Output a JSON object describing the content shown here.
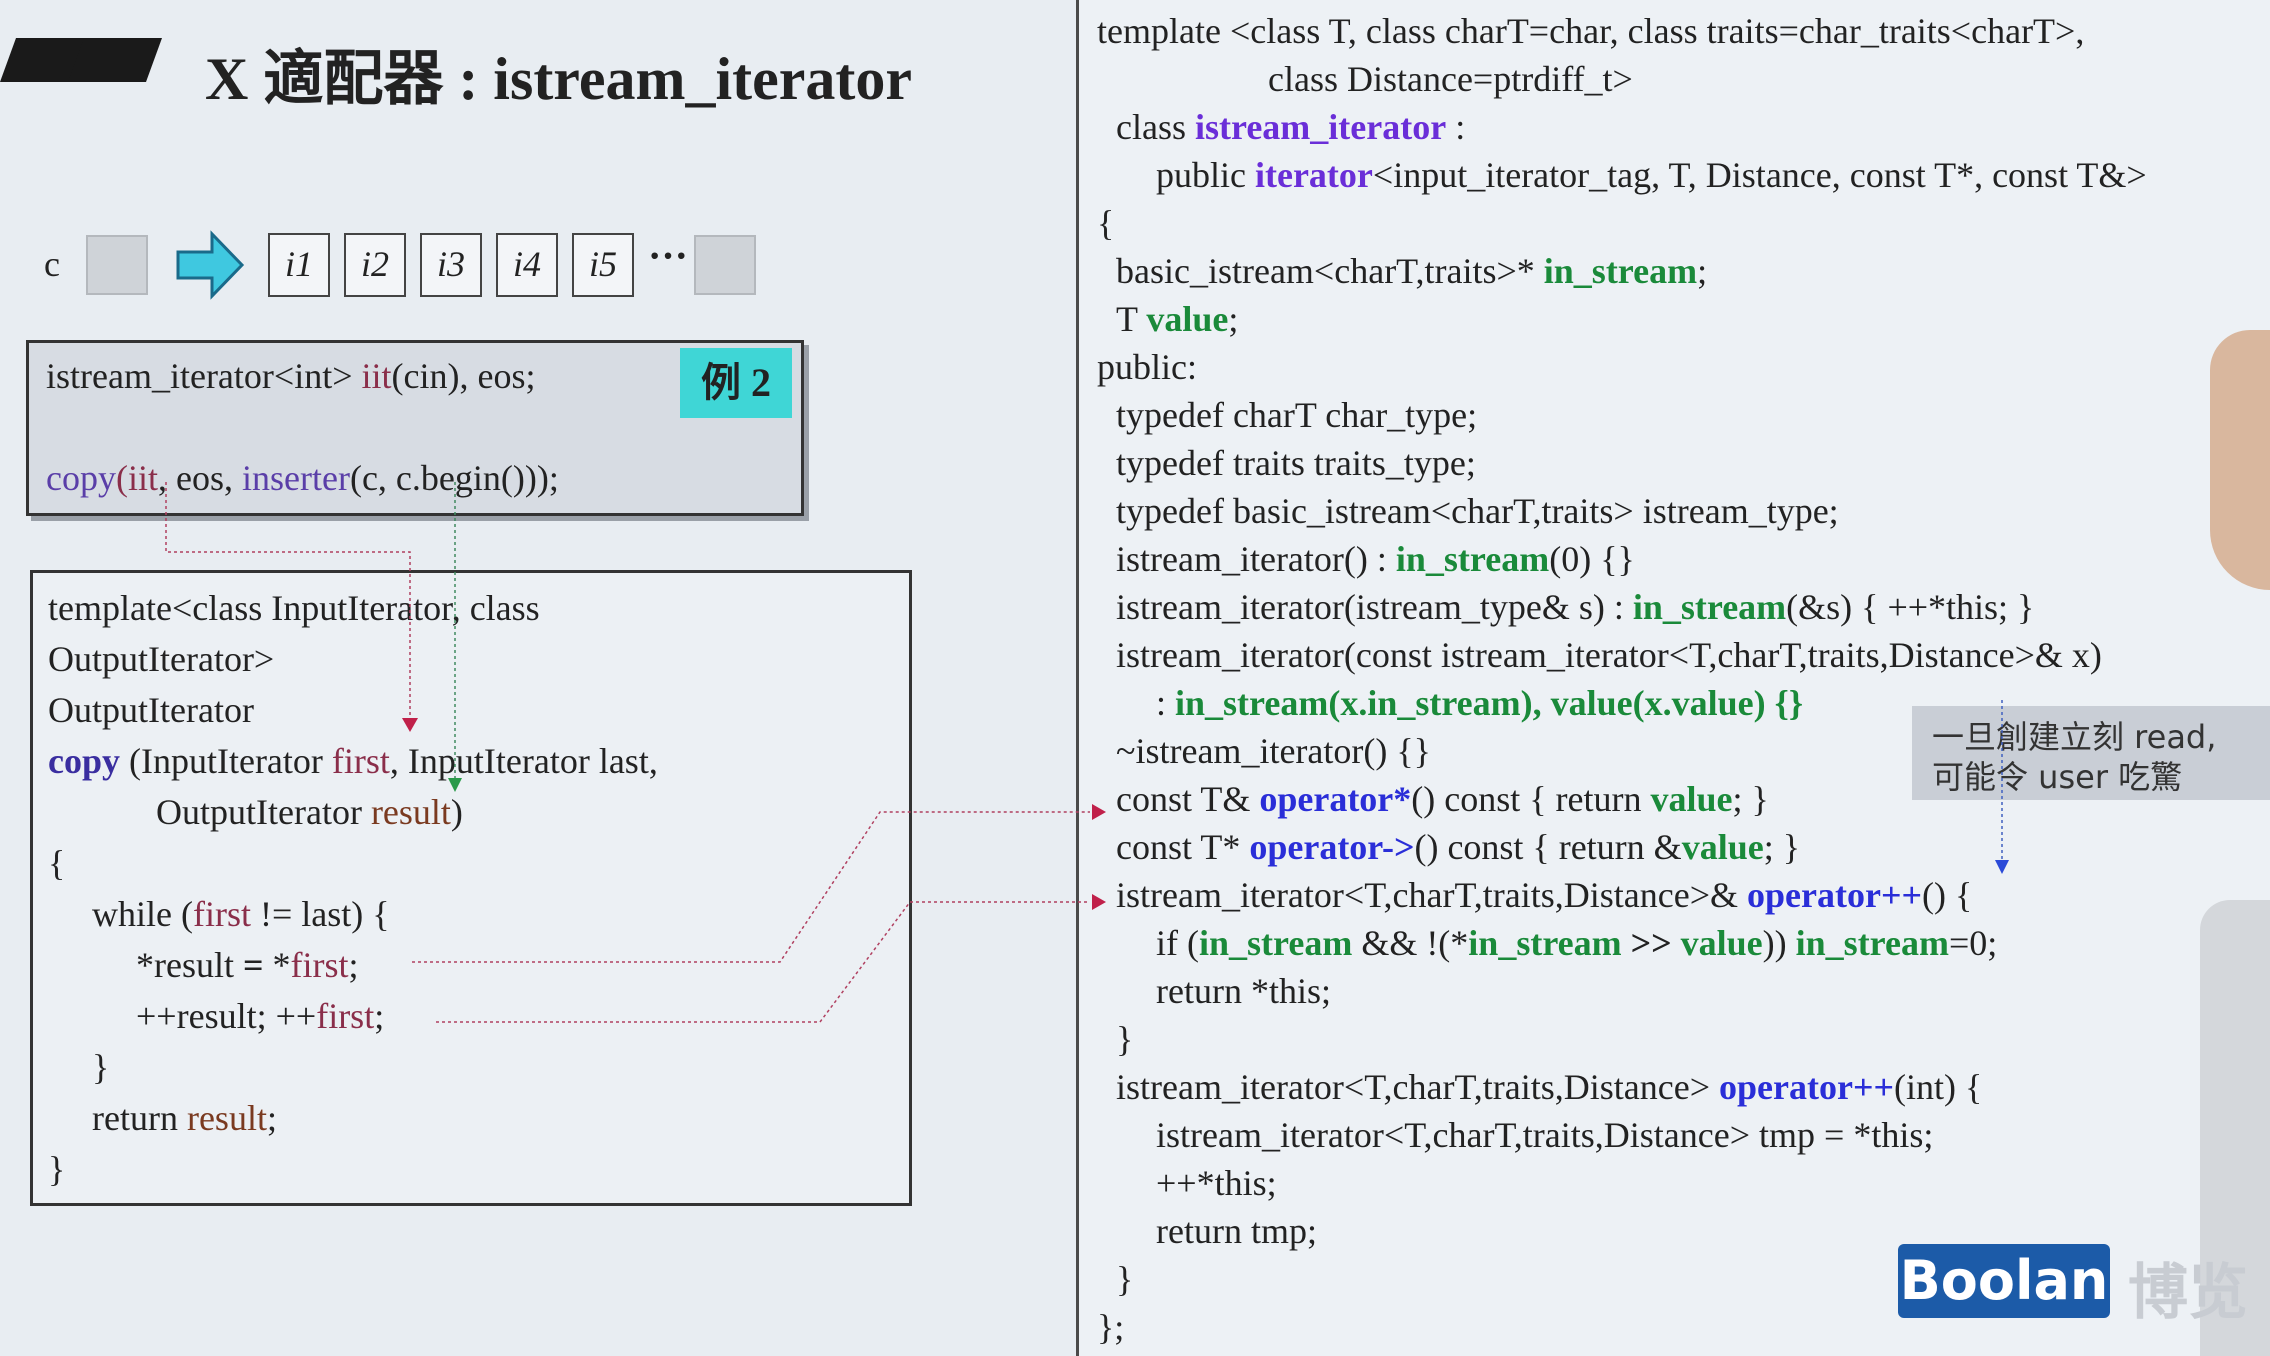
{
  "slide": {
    "title": "X 適配器 : istream_iterator",
    "container": {
      "label": "c",
      "items": [
        "i1",
        "i2",
        "i3",
        "i4",
        "i5"
      ],
      "ellipsis": "···"
    },
    "example": {
      "badge": "例 2",
      "line1": {
        "a": "istream_iterator<int> ",
        "b": "iit",
        "c": "(cin), eos;"
      },
      "line2": {
        "a": "copy",
        "b": "(",
        "c": "iit",
        "d": ", eos, ",
        "e": "inserter",
        "f": "(c, c.begin()));"
      }
    },
    "copy_code": {
      "l1": "template<class InputIterator, class",
      "l2": "OutputIterator>",
      "l3": "OutputIterator",
      "l4": {
        "a": "copy",
        "b": " (InputIterator ",
        "c": "first",
        "d": ", InputIterator last,"
      },
      "l5": {
        "a": "OutputIterator ",
        "b": "result",
        "c": ")"
      },
      "l6": "{",
      "l7": {
        "a": "while (",
        "b": "first",
        "c": " != last) {"
      },
      "l8": {
        "a": "*result ",
        "b": "=",
        "c": " *",
        "d": "first",
        "e": ";"
      },
      "l9": {
        "a": "++result; ++",
        "b": "first",
        "c": ";"
      },
      "l10": "}",
      "l11": {
        "a": "return ",
        "b": "result",
        "c": ";"
      },
      "l12": "}"
    },
    "class_code": {
      "r1": "template <class T, class charT=char, class traits=char_traits<charT>,",
      "r2": "class Distance=ptrdiff_t>",
      "r3": {
        "a": "class ",
        "b": "istream_iterator",
        "c": " :"
      },
      "r4": {
        "a": "public ",
        "b": "iterator",
        "c": "<input_iterator_tag, T, Distance, const T*, const T&>"
      },
      "r5": "{",
      "r6": {
        "a": "basic_istream<charT,traits>* ",
        "b": "in_stream",
        "c": ";"
      },
      "r7": {
        "a": "T ",
        "b": "value",
        "c": ";"
      },
      "r8": "public:",
      "r9": "typedef charT char_type;",
      "r10": "typedef traits traits_type;",
      "r11": "typedef basic_istream<charT,traits> istream_type;",
      "r12": {
        "a": "istream_iterator() : ",
        "b": "in_stream",
        "c": "(0) {}"
      },
      "r13": {
        "a": "istream_iterator(istream_type& s) : ",
        "b": "in_stream",
        "c": "(&s) { ++*this; }"
      },
      "r14": "istream_iterator(const istream_iterator<T,charT,traits,Distance>& x)",
      "r15": {
        "a": ": ",
        "b": "in_stream",
        "c": "(x.in_stream), ",
        "d": "value",
        "e": "(x.value) {}"
      },
      "r16": "~istream_iterator() {}",
      "r17": {
        "a": "const T& ",
        "b": "operator*",
        "c": "() const { return ",
        "d": "value",
        "e": "; }"
      },
      "r18": {
        "a": "const T* ",
        "b": "operator->",
        "c": "() const { return &",
        "d": "value",
        "e": "; }"
      },
      "r19": {
        "a": "istream_iterator<T,charT,traits,Distance>& ",
        "b": "operator++",
        "c": "() {"
      },
      "r20": {
        "a": "if (",
        "b": "in_stream",
        "c": " && !(*",
        "d": "in_stream",
        "e": " >> ",
        "f": "value",
        "g": ")) ",
        "h": "in_stream",
        "i": "=0;"
      },
      "r21": "return *this;",
      "r22": "}",
      "r23": {
        "a": "istream_iterator<T,charT,traits,Distance> ",
        "b": "operator++",
        "c": "(int) {"
      },
      "r24": "istream_iterator<T,charT,traits,Distance> tmp = *this;",
      "r25": "++*this;",
      "r26": "return tmp;",
      "r27": "}",
      "r28": "};"
    },
    "annotation": {
      "line1": "一旦創建立刻 read,",
      "line2": "可能令 user 吃驚"
    },
    "logo": {
      "text": "Boolan",
      "cn": "博览"
    },
    "colors": {
      "accent_cyan": "#3fd6d6",
      "keyword_blue": "#2a2ed8",
      "member_green": "#1a8a3a",
      "arrow_red": "#c0204a",
      "logo_blue": "#1c5ba8"
    },
    "icons": [
      "right-arrow-icon",
      "down-arrow-icon",
      "right-pointer-icon"
    ]
  }
}
